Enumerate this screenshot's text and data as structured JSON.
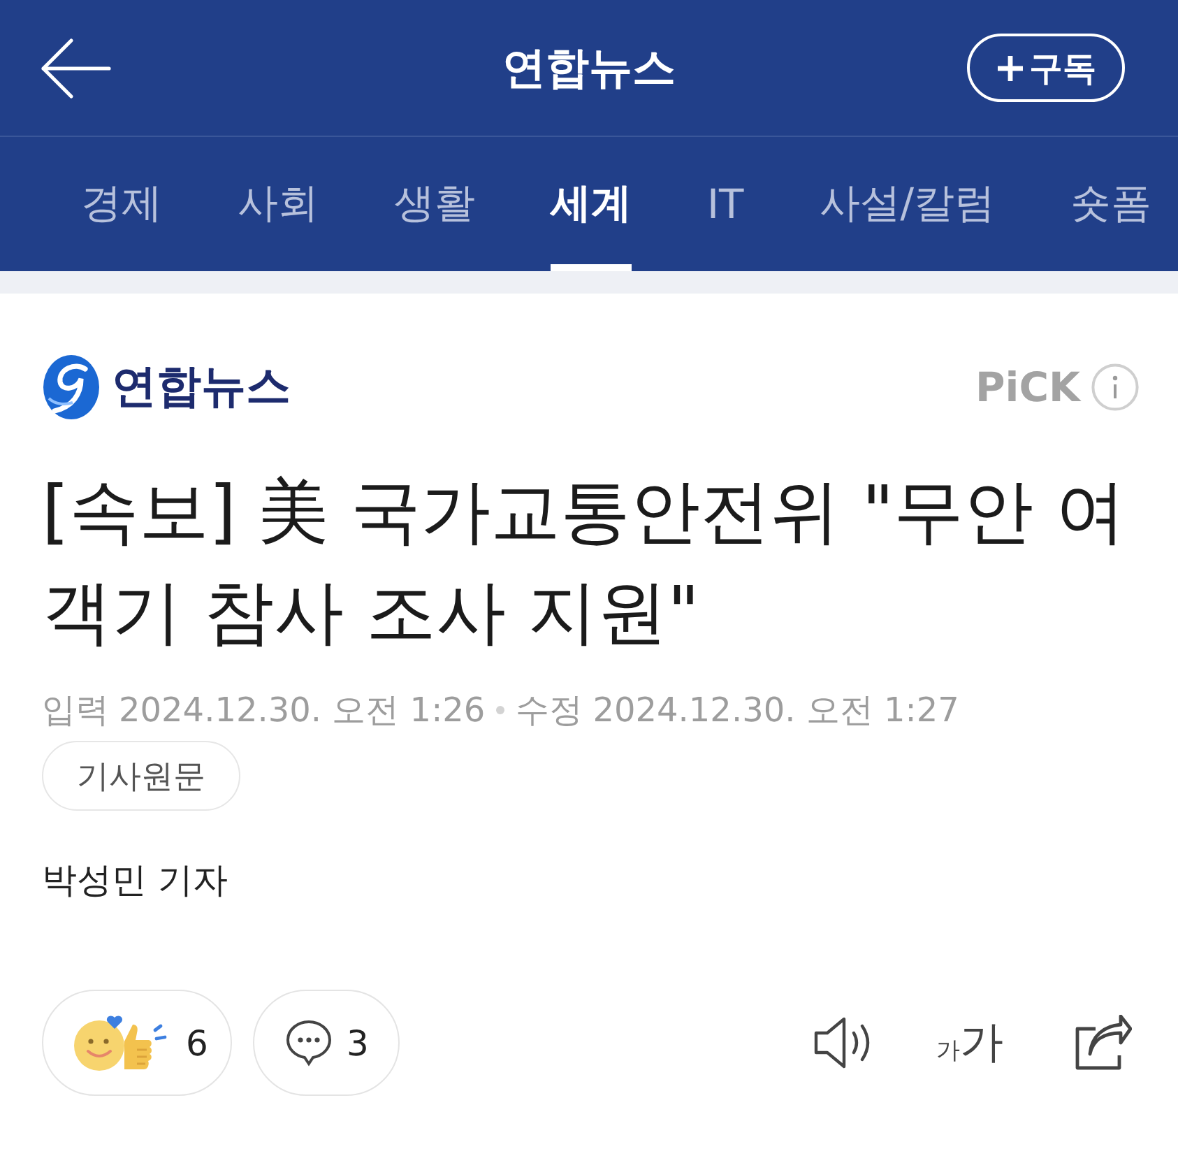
{
  "header": {
    "title": "연합뉴스",
    "subscribe_button": "구독"
  },
  "tabs": [
    {
      "label": "경제",
      "selected": false
    },
    {
      "label": "사회",
      "selected": false
    },
    {
      "label": "생활",
      "selected": false
    },
    {
      "label": "세계",
      "selected": true
    },
    {
      "label": "IT",
      "selected": false
    },
    {
      "label": "사설/칼럼",
      "selected": false
    },
    {
      "label": "숏폼",
      "selected": false
    }
  ],
  "press": {
    "logo_text": "연합뉴스",
    "pick_badge": "PiCK"
  },
  "article": {
    "headline": "[속보] 美 국가교통안전위 \"무안 여객기 참사 조사 지원\"",
    "timestamps": [
      {
        "label": "입력",
        "value": "2024.12.30. 오전 1:26"
      },
      {
        "label": "수정",
        "value": "2024.12.30. 오전 1:27"
      }
    ],
    "original_link": "기사원문",
    "byline": "박성민 기자"
  },
  "actions": {
    "reactions": "6",
    "comments": "3",
    "font_size": {
      "small": "가",
      "large": "가"
    }
  }
}
